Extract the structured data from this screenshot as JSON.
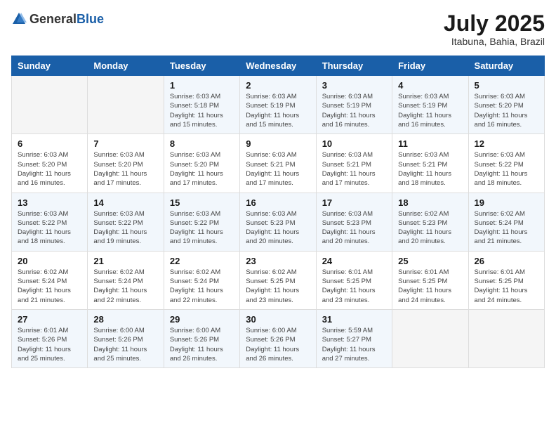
{
  "header": {
    "logo_general": "General",
    "logo_blue": "Blue",
    "month_year": "July 2025",
    "location": "Itabuna, Bahia, Brazil"
  },
  "weekdays": [
    "Sunday",
    "Monday",
    "Tuesday",
    "Wednesday",
    "Thursday",
    "Friday",
    "Saturday"
  ],
  "weeks": [
    [
      {
        "day": "",
        "sunrise": "",
        "sunset": "",
        "daylight": "",
        "empty": true
      },
      {
        "day": "",
        "sunrise": "",
        "sunset": "",
        "daylight": "",
        "empty": true
      },
      {
        "day": "1",
        "sunrise": "Sunrise: 6:03 AM",
        "sunset": "Sunset: 5:18 PM",
        "daylight": "Daylight: 11 hours and 15 minutes."
      },
      {
        "day": "2",
        "sunrise": "Sunrise: 6:03 AM",
        "sunset": "Sunset: 5:19 PM",
        "daylight": "Daylight: 11 hours and 15 minutes."
      },
      {
        "day": "3",
        "sunrise": "Sunrise: 6:03 AM",
        "sunset": "Sunset: 5:19 PM",
        "daylight": "Daylight: 11 hours and 16 minutes."
      },
      {
        "day": "4",
        "sunrise": "Sunrise: 6:03 AM",
        "sunset": "Sunset: 5:19 PM",
        "daylight": "Daylight: 11 hours and 16 minutes."
      },
      {
        "day": "5",
        "sunrise": "Sunrise: 6:03 AM",
        "sunset": "Sunset: 5:20 PM",
        "daylight": "Daylight: 11 hours and 16 minutes."
      }
    ],
    [
      {
        "day": "6",
        "sunrise": "Sunrise: 6:03 AM",
        "sunset": "Sunset: 5:20 PM",
        "daylight": "Daylight: 11 hours and 16 minutes."
      },
      {
        "day": "7",
        "sunrise": "Sunrise: 6:03 AM",
        "sunset": "Sunset: 5:20 PM",
        "daylight": "Daylight: 11 hours and 17 minutes."
      },
      {
        "day": "8",
        "sunrise": "Sunrise: 6:03 AM",
        "sunset": "Sunset: 5:20 PM",
        "daylight": "Daylight: 11 hours and 17 minutes."
      },
      {
        "day": "9",
        "sunrise": "Sunrise: 6:03 AM",
        "sunset": "Sunset: 5:21 PM",
        "daylight": "Daylight: 11 hours and 17 minutes."
      },
      {
        "day": "10",
        "sunrise": "Sunrise: 6:03 AM",
        "sunset": "Sunset: 5:21 PM",
        "daylight": "Daylight: 11 hours and 17 minutes."
      },
      {
        "day": "11",
        "sunrise": "Sunrise: 6:03 AM",
        "sunset": "Sunset: 5:21 PM",
        "daylight": "Daylight: 11 hours and 18 minutes."
      },
      {
        "day": "12",
        "sunrise": "Sunrise: 6:03 AM",
        "sunset": "Sunset: 5:22 PM",
        "daylight": "Daylight: 11 hours and 18 minutes."
      }
    ],
    [
      {
        "day": "13",
        "sunrise": "Sunrise: 6:03 AM",
        "sunset": "Sunset: 5:22 PM",
        "daylight": "Daylight: 11 hours and 18 minutes."
      },
      {
        "day": "14",
        "sunrise": "Sunrise: 6:03 AM",
        "sunset": "Sunset: 5:22 PM",
        "daylight": "Daylight: 11 hours and 19 minutes."
      },
      {
        "day": "15",
        "sunrise": "Sunrise: 6:03 AM",
        "sunset": "Sunset: 5:22 PM",
        "daylight": "Daylight: 11 hours and 19 minutes."
      },
      {
        "day": "16",
        "sunrise": "Sunrise: 6:03 AM",
        "sunset": "Sunset: 5:23 PM",
        "daylight": "Daylight: 11 hours and 20 minutes."
      },
      {
        "day": "17",
        "sunrise": "Sunrise: 6:03 AM",
        "sunset": "Sunset: 5:23 PM",
        "daylight": "Daylight: 11 hours and 20 minutes."
      },
      {
        "day": "18",
        "sunrise": "Sunrise: 6:02 AM",
        "sunset": "Sunset: 5:23 PM",
        "daylight": "Daylight: 11 hours and 20 minutes."
      },
      {
        "day": "19",
        "sunrise": "Sunrise: 6:02 AM",
        "sunset": "Sunset: 5:24 PM",
        "daylight": "Daylight: 11 hours and 21 minutes."
      }
    ],
    [
      {
        "day": "20",
        "sunrise": "Sunrise: 6:02 AM",
        "sunset": "Sunset: 5:24 PM",
        "daylight": "Daylight: 11 hours and 21 minutes."
      },
      {
        "day": "21",
        "sunrise": "Sunrise: 6:02 AM",
        "sunset": "Sunset: 5:24 PM",
        "daylight": "Daylight: 11 hours and 22 minutes."
      },
      {
        "day": "22",
        "sunrise": "Sunrise: 6:02 AM",
        "sunset": "Sunset: 5:24 PM",
        "daylight": "Daylight: 11 hours and 22 minutes."
      },
      {
        "day": "23",
        "sunrise": "Sunrise: 6:02 AM",
        "sunset": "Sunset: 5:25 PM",
        "daylight": "Daylight: 11 hours and 23 minutes."
      },
      {
        "day": "24",
        "sunrise": "Sunrise: 6:01 AM",
        "sunset": "Sunset: 5:25 PM",
        "daylight": "Daylight: 11 hours and 23 minutes."
      },
      {
        "day": "25",
        "sunrise": "Sunrise: 6:01 AM",
        "sunset": "Sunset: 5:25 PM",
        "daylight": "Daylight: 11 hours and 24 minutes."
      },
      {
        "day": "26",
        "sunrise": "Sunrise: 6:01 AM",
        "sunset": "Sunset: 5:25 PM",
        "daylight": "Daylight: 11 hours and 24 minutes."
      }
    ],
    [
      {
        "day": "27",
        "sunrise": "Sunrise: 6:01 AM",
        "sunset": "Sunset: 5:26 PM",
        "daylight": "Daylight: 11 hours and 25 minutes."
      },
      {
        "day": "28",
        "sunrise": "Sunrise: 6:00 AM",
        "sunset": "Sunset: 5:26 PM",
        "daylight": "Daylight: 11 hours and 25 minutes."
      },
      {
        "day": "29",
        "sunrise": "Sunrise: 6:00 AM",
        "sunset": "Sunset: 5:26 PM",
        "daylight": "Daylight: 11 hours and 26 minutes."
      },
      {
        "day": "30",
        "sunrise": "Sunrise: 6:00 AM",
        "sunset": "Sunset: 5:26 PM",
        "daylight": "Daylight: 11 hours and 26 minutes."
      },
      {
        "day": "31",
        "sunrise": "Sunrise: 5:59 AM",
        "sunset": "Sunset: 5:27 PM",
        "daylight": "Daylight: 11 hours and 27 minutes."
      },
      {
        "day": "",
        "sunrise": "",
        "sunset": "",
        "daylight": "",
        "empty": true
      },
      {
        "day": "",
        "sunrise": "",
        "sunset": "",
        "daylight": "",
        "empty": true
      }
    ]
  ]
}
